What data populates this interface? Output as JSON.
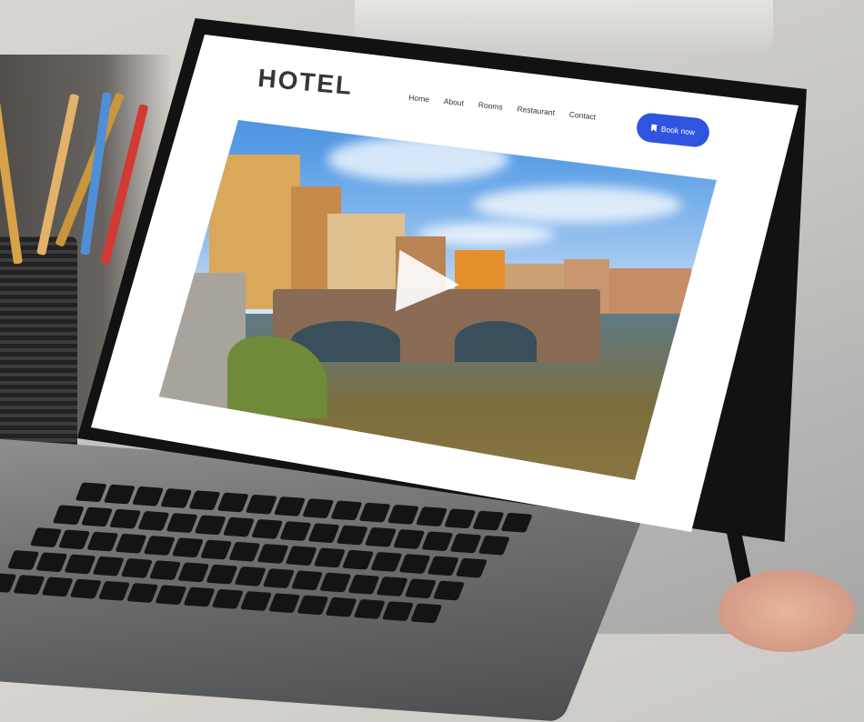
{
  "site": {
    "logo": "HOTEL",
    "nav": [
      "Home",
      "About",
      "Rooms",
      "Restaurant",
      "Contact"
    ],
    "cta": "Book now"
  },
  "hero": {
    "media": "video",
    "play_icon": "play-icon"
  },
  "icons": {
    "book_button_icon": "bookmark-icon"
  },
  "colors": {
    "accent": "#2f55e0",
    "logo": "#33363b"
  }
}
